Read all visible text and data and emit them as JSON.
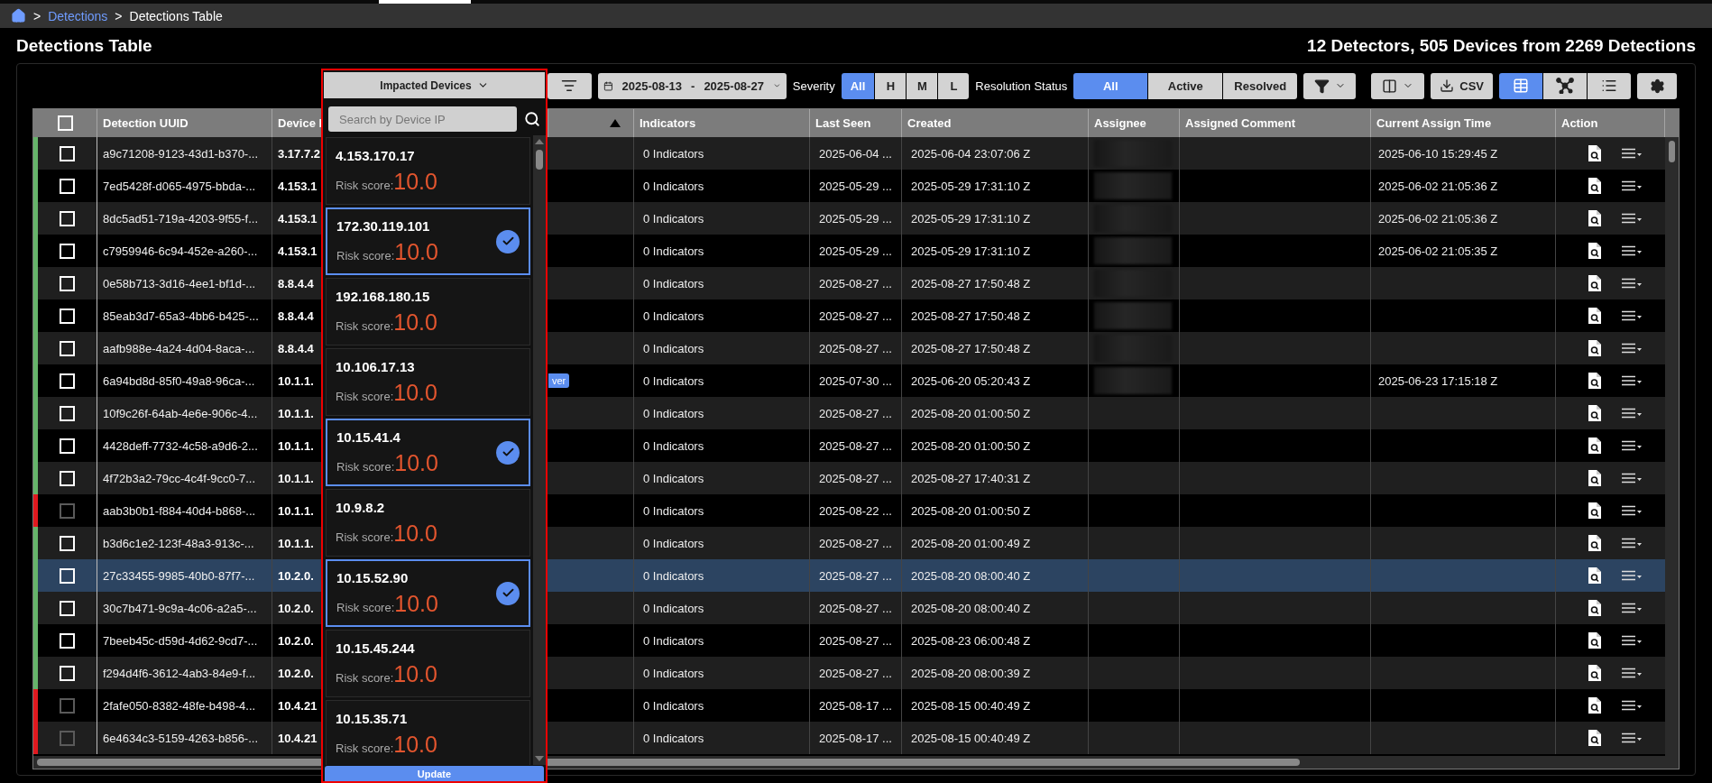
{
  "breadcrumb": [
    {
      "separator": ">",
      "label": "Detections",
      "kind": "link"
    },
    {
      "separator": ">",
      "label": "Detections Table",
      "kind": "current"
    }
  ],
  "page": {
    "title": "Detections Table",
    "summary": "12 Detectors, 505 Devices from 2269 Detections"
  },
  "toolbar": {
    "date_range": {
      "start": "2025-08-13",
      "separator": "-",
      "end": "2025-08-27"
    },
    "severity": {
      "label": "Severity",
      "options": [
        {
          "label": "All",
          "selected": true
        },
        {
          "label": "H",
          "selected": false
        },
        {
          "label": "M",
          "selected": false
        },
        {
          "label": "L",
          "selected": false
        }
      ]
    },
    "resolution_status": {
      "label": "Resolution Status",
      "options": [
        {
          "label": "All",
          "selected": true
        },
        {
          "label": "Active",
          "selected": false
        },
        {
          "label": "Resolved",
          "selected": false
        }
      ]
    },
    "export_button": "CSV",
    "views": [
      {
        "kind": "table",
        "selected": true
      },
      {
        "kind": "graph",
        "selected": false
      },
      {
        "kind": "list",
        "selected": false
      }
    ]
  },
  "device_filter": {
    "button": "Impacted Devices",
    "placeholder": "Search by Device IP",
    "update_button": "Update",
    "devices": [
      {
        "ip": "4.153.170.17",
        "risk_label": "Risk score:",
        "risk": "10.0",
        "selected": false
      },
      {
        "ip": "172.30.119.101",
        "risk_label": "Risk score:",
        "risk": "10.0",
        "selected": true
      },
      {
        "ip": "192.168.180.15",
        "risk_label": "Risk score:",
        "risk": "10.0",
        "selected": false
      },
      {
        "ip": "10.106.17.13",
        "risk_label": "Risk score:",
        "risk": "10.0",
        "selected": false
      },
      {
        "ip": "10.15.41.4",
        "risk_label": "Risk score:",
        "risk": "10.0",
        "selected": true
      },
      {
        "ip": "10.9.8.2",
        "risk_label": "Risk score:",
        "risk": "10.0",
        "selected": false
      },
      {
        "ip": "10.15.52.90",
        "risk_label": "Risk score:",
        "risk": "10.0",
        "selected": true
      },
      {
        "ip": "10.15.45.244",
        "risk_label": "Risk score:",
        "risk": "10.0",
        "selected": false
      },
      {
        "ip": "10.15.35.71",
        "risk_label": "Risk score:",
        "risk": "10.0",
        "selected": false
      }
    ]
  },
  "table": {
    "columns": [
      {
        "kind": "checkbox",
        "checked": false
      },
      {
        "kind": "text",
        "label": "Detection UUID"
      },
      {
        "kind": "text",
        "label": "Device I"
      },
      {
        "kind": "sort",
        "ascending": true
      },
      {
        "kind": "text",
        "label": "Indicators"
      },
      {
        "kind": "text",
        "label": "Last Seen"
      },
      {
        "kind": "text",
        "label": "Created"
      },
      {
        "kind": "text",
        "label": "Assignee"
      },
      {
        "kind": "text",
        "label": "Assigned Comment"
      },
      {
        "kind": "text",
        "label": "Current Assign Time"
      },
      {
        "kind": "text",
        "label": "Action"
      }
    ],
    "rows": [
      {
        "color": "#66b36a",
        "selected": false,
        "checked": false,
        "disabled": false,
        "uuid": "a9c71208-9123-43d1-b370-...",
        "device": "3.17.7.2",
        "indicators": "0 Indicators",
        "last_seen": "2025-06-04 ...",
        "created": "2025-06-04 23:07:06 Z",
        "redacted": true,
        "assign_time": "2025-06-10 15:29:45 Z"
      },
      {
        "color": "#66b36a",
        "selected": false,
        "checked": false,
        "disabled": false,
        "uuid": "7ed5428f-d065-4975-bbda-...",
        "device": "4.153.1",
        "indicators": "0 Indicators",
        "last_seen": "2025-05-29 ...",
        "created": "2025-05-29 17:31:10 Z",
        "redacted": true,
        "assign_time": "2025-06-02 21:05:36 Z"
      },
      {
        "color": "#66b36a",
        "selected": false,
        "checked": false,
        "disabled": false,
        "uuid": "8dc5ad51-719a-4203-9f55-f...",
        "device": "4.153.1",
        "indicators": "0 Indicators",
        "last_seen": "2025-05-29 ...",
        "created": "2025-05-29 17:31:10 Z",
        "redacted": true,
        "assign_time": "2025-06-02 21:05:36 Z"
      },
      {
        "color": "#66b36a",
        "selected": false,
        "checked": false,
        "disabled": false,
        "uuid": "c7959946-6c94-452e-a260-...",
        "device": "4.153.1",
        "indicators": "0 Indicators",
        "last_seen": "2025-05-29 ...",
        "created": "2025-05-29 17:31:10 Z",
        "redacted": true,
        "assign_time": "2025-06-02 21:05:35 Z"
      },
      {
        "color": "#66b36a",
        "selected": false,
        "checked": false,
        "disabled": false,
        "uuid": "0e58b713-3d16-4ee1-bf1d-...",
        "device": "8.8.4.4",
        "indicators": "0 Indicators",
        "last_seen": "2025-08-27 ...",
        "created": "2025-08-27 17:50:48 Z",
        "redacted": true
      },
      {
        "color": "#66b36a",
        "selected": false,
        "checked": false,
        "disabled": false,
        "uuid": "85eab3d7-65a3-4bb6-b425-...",
        "device": "8.8.4.4",
        "indicators": "0 Indicators",
        "last_seen": "2025-08-27 ...",
        "created": "2025-08-27 17:50:48 Z",
        "redacted": true
      },
      {
        "color": "#66b36a",
        "selected": false,
        "checked": false,
        "disabled": false,
        "uuid": "aafb988e-4a24-4d04-8aca-...",
        "device": "8.8.4.4",
        "indicators": "0 Indicators",
        "last_seen": "2025-08-27 ...",
        "created": "2025-08-27 17:50:48 Z",
        "redacted": true
      },
      {
        "color": "#66b36a",
        "selected": false,
        "checked": false,
        "disabled": false,
        "uuid": "6a94bd8d-85f0-49a8-96ca-...",
        "device": "10.1.1.",
        "tag": "ver",
        "indicators": "0 Indicators",
        "last_seen": "2025-07-30 ...",
        "created": "2025-06-20 05:20:43 Z",
        "redacted": true,
        "assign_time": "2025-06-23 17:15:18 Z"
      },
      {
        "color": "#66b36a",
        "selected": false,
        "checked": false,
        "disabled": false,
        "uuid": "10f9c26f-64ab-4e6e-906c-4...",
        "device": "10.1.1.",
        "indicators": "0 Indicators",
        "last_seen": "2025-08-27 ...",
        "created": "2025-08-20 01:00:50 Z",
        "redacted": false
      },
      {
        "color": "#66b36a",
        "selected": false,
        "checked": false,
        "disabled": false,
        "uuid": "4428deff-7732-4c58-a9d6-2...",
        "device": "10.1.1.",
        "indicators": "0 Indicators",
        "last_seen": "2025-08-27 ...",
        "created": "2025-08-20 01:00:50 Z",
        "redacted": false
      },
      {
        "color": "#66b36a",
        "selected": false,
        "checked": false,
        "disabled": false,
        "uuid": "4f72b3a2-79cc-4c4f-9cc0-7...",
        "device": "10.1.1.",
        "indicators": "0 Indicators",
        "last_seen": "2025-08-27 ...",
        "created": "2025-08-27 17:40:31 Z",
        "redacted": false
      },
      {
        "color": "#e0191f",
        "selected": false,
        "checked": false,
        "disabled": true,
        "uuid": "aab3b0b1-f884-40d4-b868-...",
        "device": "10.1.1.",
        "indicators": "0 Indicators",
        "last_seen": "2025-08-22 ...",
        "created": "2025-08-20 01:00:50 Z",
        "redacted": false
      },
      {
        "color": "#66b36a",
        "selected": false,
        "checked": false,
        "disabled": false,
        "uuid": "b3d6c1e2-123f-48a3-913c-...",
        "device": "10.1.1.",
        "indicators": "0 Indicators",
        "last_seen": "2025-08-27 ...",
        "created": "2025-08-20 01:00:49 Z",
        "redacted": false
      },
      {
        "color": "#66b36a",
        "selected": true,
        "checked": false,
        "disabled": false,
        "uuid": "27c33455-9985-40b0-87f7-...",
        "device": "10.2.0.",
        "indicators": "0 Indicators",
        "last_seen": "2025-08-27 ...",
        "created": "2025-08-20 08:00:40 Z",
        "redacted": false
      },
      {
        "color": "#66b36a",
        "selected": false,
        "checked": false,
        "disabled": false,
        "uuid": "30c7b471-9c9a-4c06-a2a5-...",
        "device": "10.2.0.",
        "indicators": "0 Indicators",
        "last_seen": "2025-08-27 ...",
        "created": "2025-08-20 08:00:40 Z",
        "redacted": false
      },
      {
        "color": "#66b36a",
        "selected": false,
        "checked": false,
        "disabled": false,
        "uuid": "7beeb45c-d59d-4d62-9cd7-...",
        "device": "10.2.0.",
        "indicators": "0 Indicators",
        "last_seen": "2025-08-27 ...",
        "created": "2025-08-23 06:00:48 Z",
        "redacted": false
      },
      {
        "color": "#66b36a",
        "selected": false,
        "checked": false,
        "disabled": false,
        "uuid": "f294d4f6-3612-4ab3-84e9-f...",
        "device": "10.2.0.",
        "indicators": "0 Indicators",
        "last_seen": "2025-08-27 ...",
        "created": "2025-08-20 08:00:39 Z",
        "redacted": false
      },
      {
        "color": "#e0191f",
        "selected": false,
        "checked": false,
        "disabled": true,
        "uuid": "2fafe050-8382-48fe-b498-4...",
        "device": "10.4.21",
        "indicators": "0 Indicators",
        "last_seen": "2025-08-17 ...",
        "created": "2025-08-15 00:40:49 Z",
        "redacted": false
      },
      {
        "color": "#e0191f",
        "selected": false,
        "checked": false,
        "disabled": true,
        "uuid": "6e4634c3-5159-4263-b856-...",
        "device": "10.4.21",
        "indicators": "0 Indicators",
        "last_seen": "2025-08-17 ...",
        "created": "2025-08-15 00:40:49 Z",
        "redacted": false
      }
    ]
  }
}
